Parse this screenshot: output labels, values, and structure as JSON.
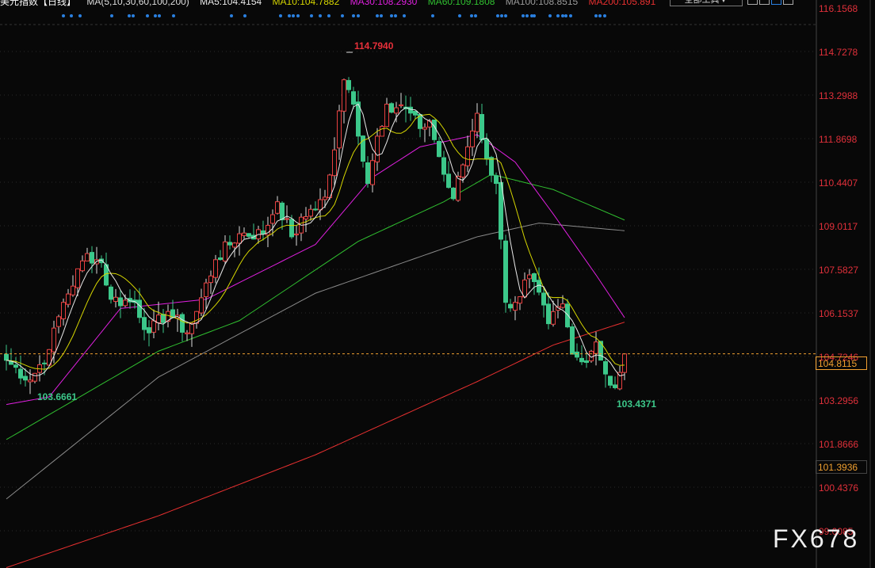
{
  "header": {
    "title": "美元指数【日线】",
    "ma_params": "MA(5,10,30,60,100,200)",
    "ma": [
      {
        "label": "MA5:104.4154",
        "color": "#e8e8e8"
      },
      {
        "label": "MA10:104.7882",
        "color": "#d6d600"
      },
      {
        "label": "MA30:108.2930",
        "color": "#e020e0"
      },
      {
        "label": "MA60:109.1808",
        "color": "#30c030"
      },
      {
        "label": "MA100:108.8515",
        "color": "#9a9a9a"
      },
      {
        "label": "MA200:105.891",
        "color": "#e83030"
      }
    ],
    "tools_button": "全部工具▼"
  },
  "price_labels": {
    "current": "104.8115",
    "marker": "101.3936",
    "high": "114.7940",
    "low_left": "103.6661",
    "low_right": "103.4371"
  },
  "watermark": "FX678",
  "chart_data": {
    "type": "candlestick",
    "y_ticks": [
      "116.1568",
      "114.7278",
      "113.2988",
      "111.8698",
      "110.4407",
      "109.0117",
      "107.5827",
      "106.1537",
      "104.7246",
      "103.2956",
      "101.8666",
      "100.4376",
      "99.0085"
    ],
    "ylim": [
      99.0085,
      116.1568
    ],
    "bar_count": 131,
    "close_anchors": [
      [
        0,
        104.6
      ],
      [
        5,
        103.95
      ],
      [
        9,
        104.95
      ],
      [
        12,
        106.5
      ],
      [
        17,
        108.1
      ],
      [
        20,
        107.8
      ],
      [
        22,
        106.6
      ],
      [
        27,
        106.5
      ],
      [
        30,
        105.5
      ],
      [
        34,
        106.2
      ],
      [
        38,
        105.5
      ],
      [
        40,
        106.2
      ],
      [
        44,
        107.9
      ],
      [
        49,
        108.75
      ],
      [
        54,
        108.75
      ],
      [
        57,
        109.8
      ],
      [
        60,
        108.65
      ],
      [
        64,
        109.55
      ],
      [
        67,
        109.95
      ],
      [
        69,
        111.5
      ],
      [
        71,
        113.8
      ],
      [
        73,
        113.0
      ],
      [
        76,
        110.4
      ],
      [
        78,
        111.95
      ],
      [
        80,
        113.0
      ],
      [
        84,
        112.85
      ],
      [
        87,
        112.2
      ],
      [
        89,
        112.45
      ],
      [
        92,
        110.7
      ],
      [
        94,
        109.9
      ],
      [
        97,
        111.6
      ],
      [
        99,
        112.7
      ],
      [
        101,
        111.2
      ],
      [
        103,
        110.4
      ],
      [
        105,
        106.5
      ],
      [
        107,
        106.5
      ],
      [
        110,
        107.4
      ],
      [
        114,
        105.8
      ],
      [
        117,
        106.45
      ],
      [
        119,
        104.8
      ],
      [
        121,
        104.55
      ],
      [
        124,
        105.2
      ],
      [
        126,
        104.15
      ],
      [
        128,
        103.7
      ],
      [
        130,
        104.81
      ]
    ],
    "ma_anchors": {
      "MA30": [
        [
          0,
          103.15
        ],
        [
          9,
          103.4
        ],
        [
          24,
          106.3
        ],
        [
          42,
          106.6
        ],
        [
          65,
          108.4
        ],
        [
          77,
          110.6
        ],
        [
          87,
          111.6
        ],
        [
          99,
          112.0
        ],
        [
          107,
          111.1
        ],
        [
          115,
          109.4
        ],
        [
          124,
          107.4
        ],
        [
          130,
          106.0
        ]
      ],
      "MA60": [
        [
          0,
          102.0
        ],
        [
          32,
          104.9
        ],
        [
          49,
          105.9
        ],
        [
          74,
          108.5
        ],
        [
          92,
          109.8
        ],
        [
          102,
          110.7
        ],
        [
          115,
          110.2
        ],
        [
          130,
          109.2
        ]
      ],
      "MA100": [
        [
          0,
          100.05
        ],
        [
          32,
          104.05
        ],
        [
          65,
          106.8
        ],
        [
          99,
          108.65
        ],
        [
          112,
          109.1
        ],
        [
          130,
          108.85
        ]
      ],
      "MA200": [
        [
          0,
          97.8
        ],
        [
          32,
          99.5
        ],
        [
          65,
          101.5
        ],
        [
          99,
          103.9
        ],
        [
          115,
          105.1
        ],
        [
          130,
          105.85
        ]
      ]
    }
  }
}
